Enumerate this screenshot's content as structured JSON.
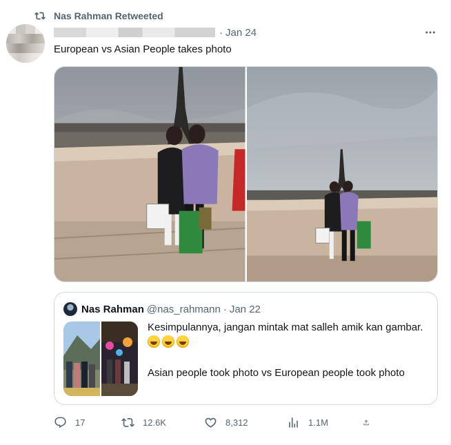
{
  "social_context": {
    "icon": "retweet-icon",
    "label": "Nas Rahman Retweeted"
  },
  "tweet": {
    "author_name_blurred": true,
    "separator": "·",
    "date": "Jan 24",
    "more_icon": "more-icon",
    "text": "European vs Asian People takes photo",
    "media": [
      {
        "alt_subject": "two women posing in front of Eiffel Tower, close-up"
      },
      {
        "alt_subject": "two women posing in front of Eiffel Tower, wide shot"
      }
    ]
  },
  "quote": {
    "author_name": "Nas Rahman",
    "handle": "@nas_rahmann",
    "separator": "·",
    "date": "Jan 22",
    "text_line1": "Kesimpulannya, jangan mintak mat salleh amik kan gambar.",
    "emoji_count": 3,
    "text_line2": "Asian people took photo vs European people took photo"
  },
  "actions": {
    "reply": {
      "icon": "reply-icon",
      "count": "17"
    },
    "retweet": {
      "icon": "retweet-icon",
      "count": "12.6K"
    },
    "like": {
      "icon": "heart-icon",
      "count": "8,312"
    },
    "views": {
      "icon": "views-icon",
      "count": "1.1M"
    },
    "share": {
      "icon": "share-icon"
    }
  },
  "colors": {
    "text": "#0f1419",
    "secondary": "#536471",
    "border": "#cfd9de"
  }
}
